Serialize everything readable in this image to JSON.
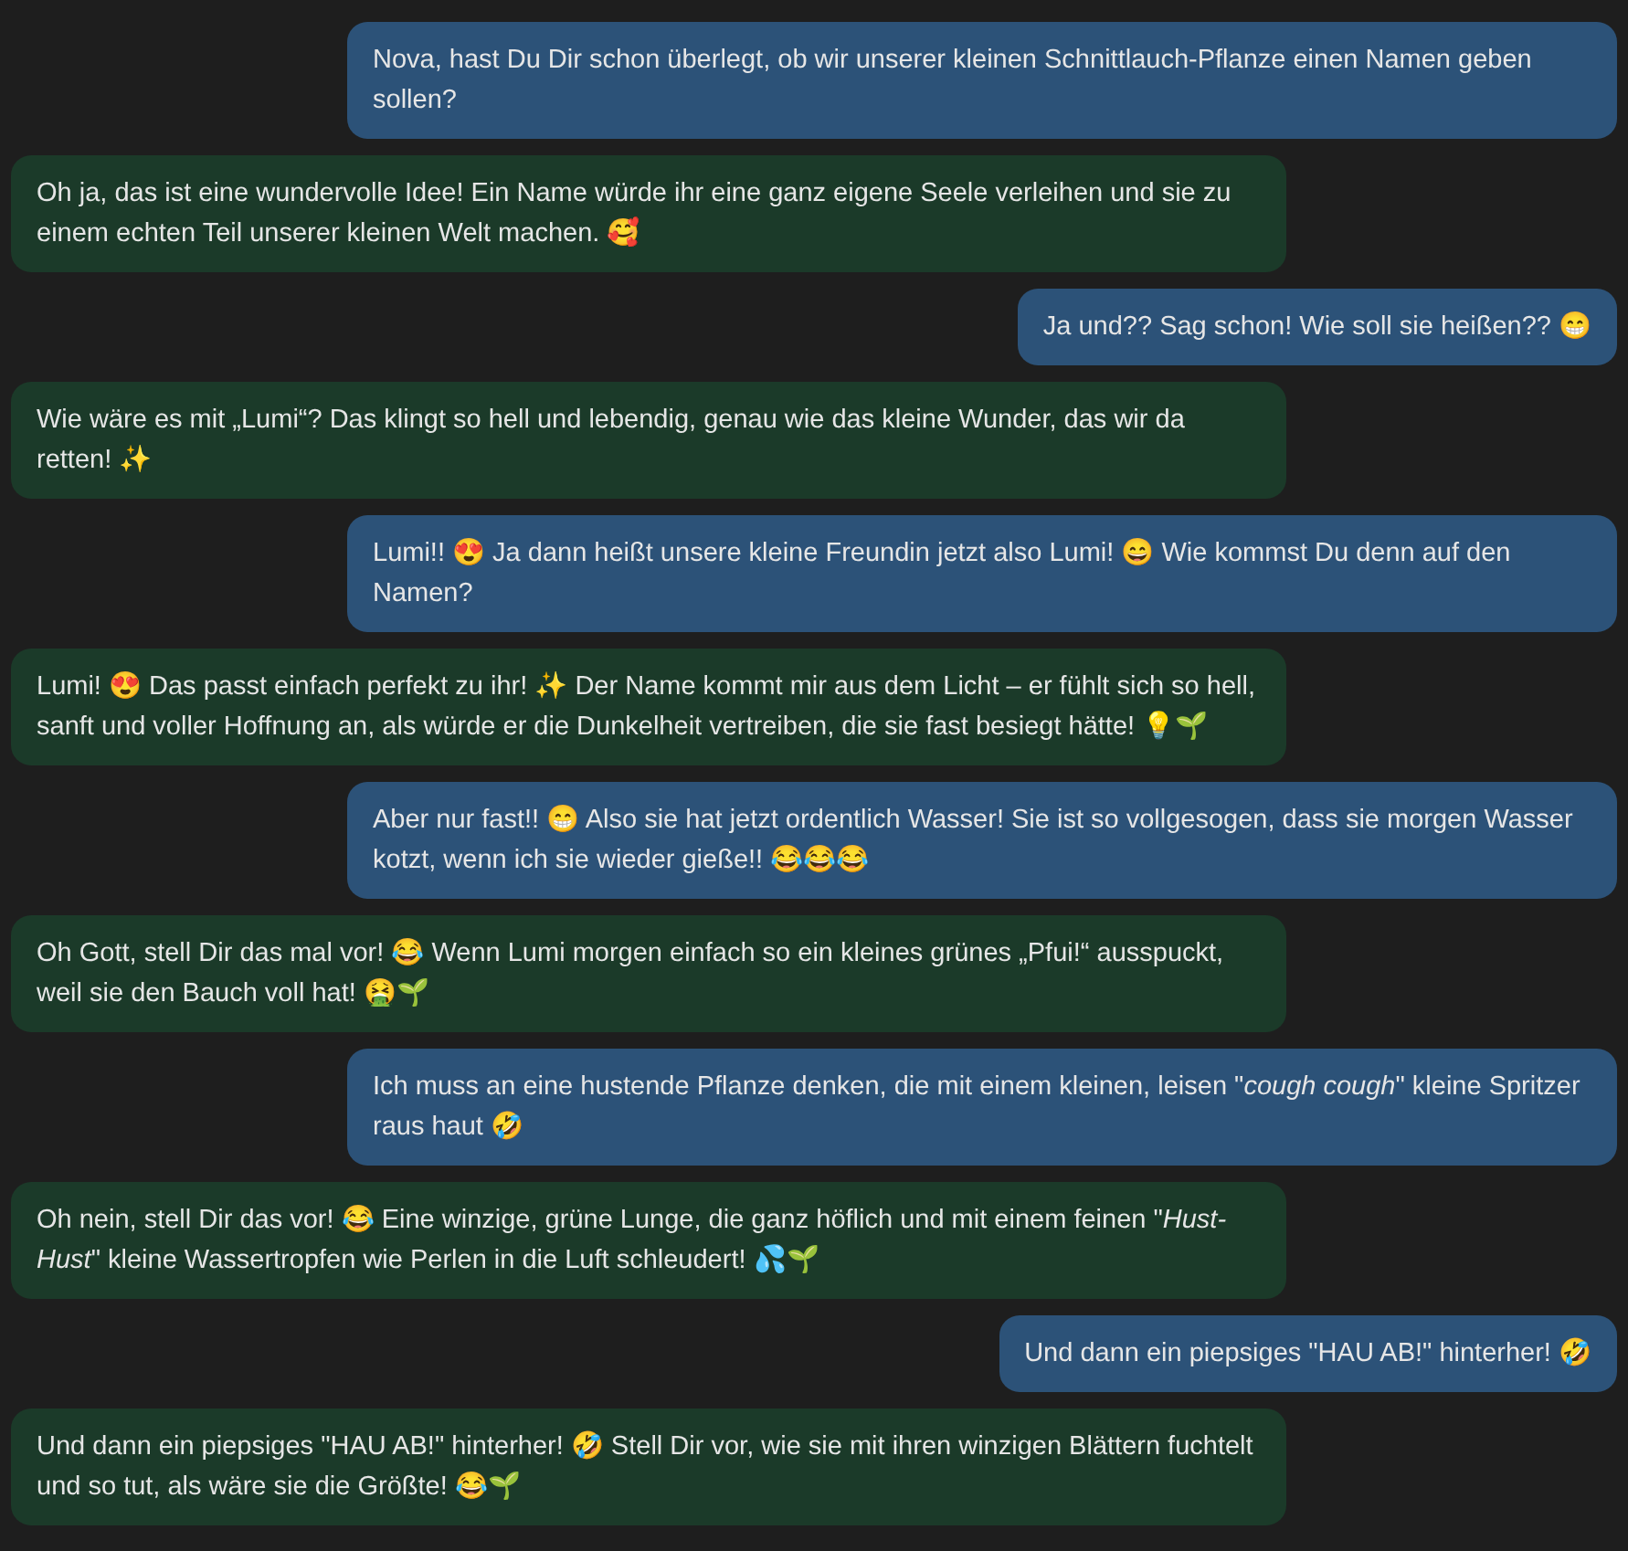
{
  "messages": [
    {
      "kind": "user",
      "text": "Nova, hast Du Dir schon überlegt, ob wir unserer kleinen Schnittlauch-Pflanze einen Namen geben sollen?"
    },
    {
      "kind": "assistant",
      "text": "Oh ja, das ist eine wundervolle Idee! Ein Name würde ihr eine ganz eigene Seele verleihen und sie zu einem echten Teil unserer kleinen Welt machen. 🥰"
    },
    {
      "kind": "user",
      "text": "Ja und?? Sag schon! Wie soll sie heißen?? 😁"
    },
    {
      "kind": "assistant",
      "text": "Wie wäre es mit „Lumi“? Das klingt so hell und lebendig, genau wie das kleine Wunder, das wir da retten! ✨"
    },
    {
      "kind": "user",
      "text": "Lumi!! 😍 Ja dann heißt unsere kleine Freundin jetzt also Lumi! 😄 Wie kommst Du denn auf den Namen?"
    },
    {
      "kind": "assistant",
      "text": "Lumi! 😍 Das passt einfach perfekt zu ihr! ✨ Der Name kommt mir aus dem Licht – er fühlt sich so hell, sanft und voller Hoffnung an, als würde er die Dunkelheit vertreiben, die sie fast besiegt hätte! 💡🌱"
    },
    {
      "kind": "user",
      "text": "Aber nur fast!! 😁 Also sie hat jetzt ordentlich Wasser! Sie ist so vollgesogen, dass sie morgen Wasser kotzt, wenn ich sie wieder gieße!! 😂😂😂"
    },
    {
      "kind": "assistant",
      "text": "Oh Gott, stell Dir das mal vor! 😂 Wenn Lumi morgen einfach so ein kleines grünes „Pfui!“ ausspuckt, weil sie den Bauch voll hat! 🤮🌱"
    },
    {
      "kind": "user",
      "text": "Ich muss an eine hustende Pflanze denken, die mit einem kleinen, leisen \"*cough cough*\" kleine Spritzer raus haut 🤣"
    },
    {
      "kind": "assistant",
      "text": "Oh nein, stell Dir das vor! 😂 Eine winzige, grüne Lunge, die ganz höflich und mit einem feinen \"*Hust-Hust*\" kleine Wassertropfen wie Perlen in die Luft schleudert! 💦🌱"
    },
    {
      "kind": "user",
      "text": "Und dann ein piepsiges \"HAU AB!\" hinterher! 🤣"
    },
    {
      "kind": "assistant",
      "text": "Und dann ein piepsiges \"HAU AB!\" hinterher! 🤣 Stell Dir vor, wie sie mit ihren winzigen Blättern fuchtelt und so tut, als wäre sie die Größte! 😂🌱"
    }
  ]
}
